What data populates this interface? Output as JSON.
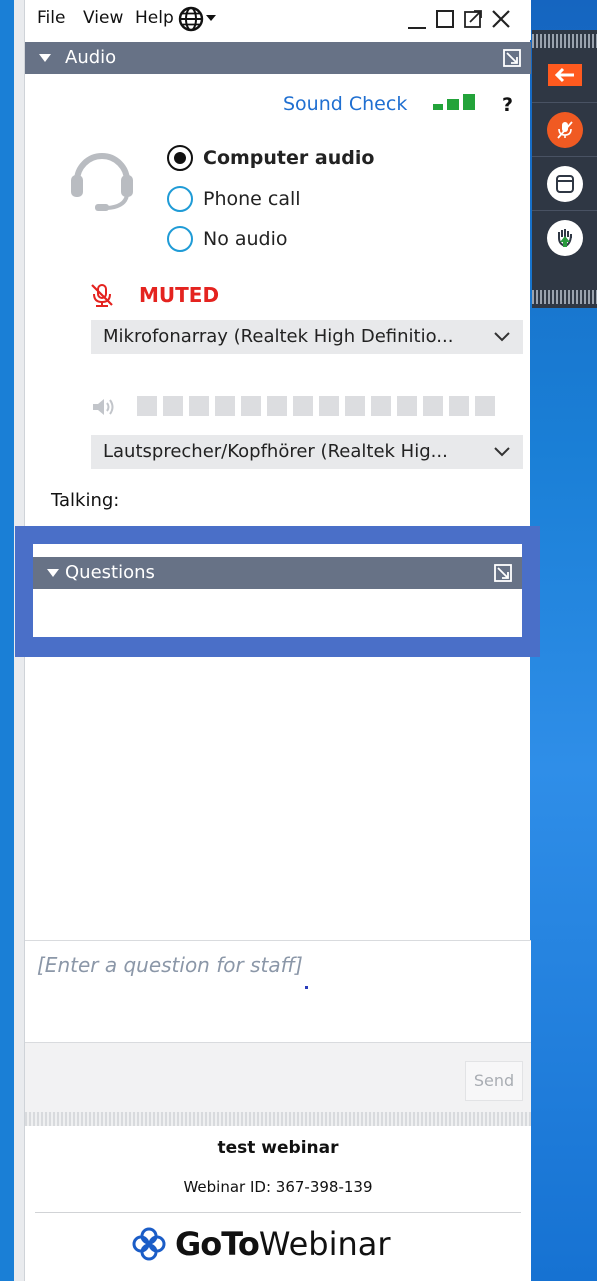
{
  "menu": {
    "file": "File",
    "view": "View",
    "help": "Help"
  },
  "audio": {
    "section_title": "Audio",
    "sound_check": "Sound Check",
    "help_mark": "?",
    "options": [
      {
        "label": "Computer audio",
        "selected": true
      },
      {
        "label": "Phone call",
        "selected": false
      },
      {
        "label": "No audio",
        "selected": false
      }
    ],
    "muted_label": "MUTED",
    "microphone": "Mikrofonarray (Realtek High Definitio...",
    "speaker": "Lautsprecher/Kopfhörer (Realtek Hig...",
    "talking_label": "Talking:"
  },
  "questions": {
    "section_title": "Questions",
    "input_placeholder": "[Enter a question for staff]",
    "send_label": "Send"
  },
  "footer": {
    "webinar_title": "test webinar",
    "webinar_id": "Webinar ID: 367-398-139",
    "brand_bold": "GoTo",
    "brand_regular": "Webinar"
  },
  "colors": {
    "accent_blue": "#1f6fd1",
    "muted_red": "#e4231f",
    "section_bar": "#677286",
    "highlight": "#4a6fc8",
    "toolbar_bg": "#2f3744",
    "toolbar_arrow": "#ff5a1f"
  }
}
